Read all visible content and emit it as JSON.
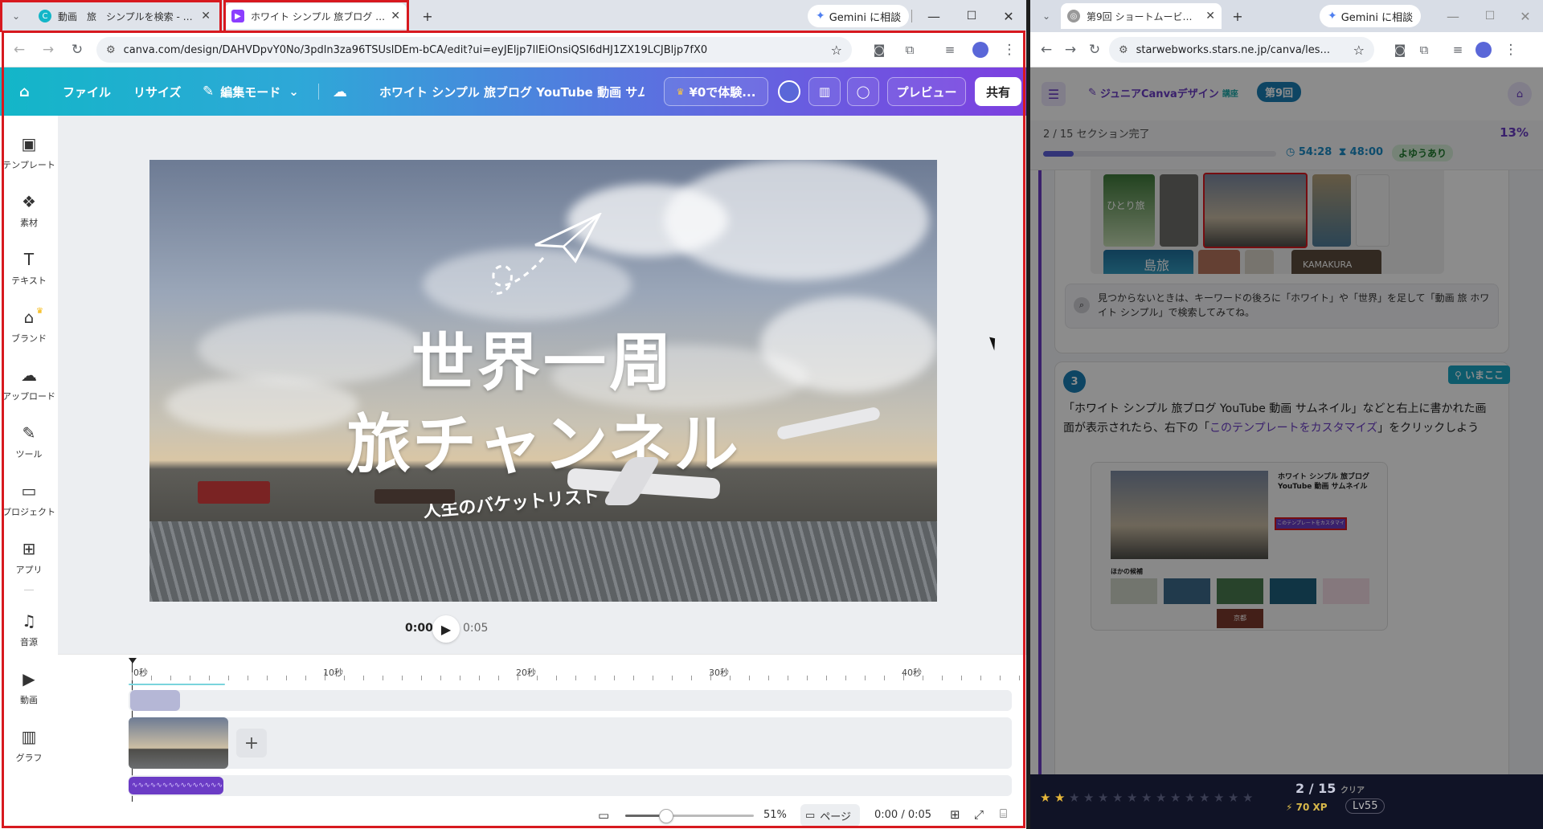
{
  "left_browser": {
    "tabs": [
      {
        "title": "動画　旅　シンプルを検索 - Canva",
        "favicon": "canva-icon"
      },
      {
        "title": "ホワイト シンプル 旅ブログ YouTube",
        "favicon": "video-icon"
      }
    ],
    "gemini_label": "Gemini に相談",
    "url": "canva.com/design/DAHVDpvY0No/3pdln3za96TSUslDEm-bCA/edit?ui=eyJEljp7llEiOnsiQSI6dHJ1ZX19LCJBljp7fX0"
  },
  "canva_header": {
    "file": "ファイル",
    "resize": "リサイズ",
    "edit_mode": "編集モード",
    "design_title": "ホワイト シンプル 旅ブログ YouTube 動画 サムネ...",
    "trial": "¥0で体験...",
    "preview": "プレビュー",
    "share": "共有"
  },
  "sidebar": {
    "items": [
      {
        "label": "テンプレート",
        "icon": "template-icon"
      },
      {
        "label": "素材",
        "icon": "elements-icon"
      },
      {
        "label": "テキスト",
        "icon": "text-icon"
      },
      {
        "label": "ブランド",
        "icon": "brand-icon"
      },
      {
        "label": "アップロード",
        "icon": "upload-icon"
      },
      {
        "label": "ツール",
        "icon": "tools-icon"
      },
      {
        "label": "プロジェクト",
        "icon": "folder-icon"
      },
      {
        "label": "アプリ",
        "icon": "apps-icon"
      },
      {
        "label": "音源",
        "icon": "music-icon"
      },
      {
        "label": "動画",
        "icon": "video-icon"
      },
      {
        "label": "グラフ",
        "icon": "chart-icon"
      }
    ]
  },
  "design": {
    "line1": "世界一周",
    "line2": "旅チャンネル",
    "subtitle": "人生のバケットリスト"
  },
  "player": {
    "current": "0:00",
    "total": "0:05"
  },
  "timeline": {
    "labels": [
      "0秒",
      "10秒",
      "20秒",
      "30秒",
      "40秒"
    ]
  },
  "status": {
    "zoom": "51%",
    "page": "ページ",
    "time": "0:00 / 0:05"
  },
  "right_browser": {
    "tab_title": "第9回 ショートムービーを作ろう | ジ...",
    "gemini_label": "Gemini に相談",
    "url": "starwebworks.stars.ne.jp/canva/les..."
  },
  "lesson": {
    "course": "ジュニアCanvaデザイン",
    "course_tag": "講座",
    "badge": "第9回",
    "progress_text": "2 / 15 セクション完了",
    "progress_pct": "13%",
    "progress_value": 0.13,
    "time_elapsed": "54:28",
    "time_limit": "48:00",
    "pace": "よゆうあり",
    "tip": "見つからないときは、キーワードの後ろに「ホワイト」や「世界」を足して「動画 旅 ホワイト シンプル」で検索してみてね。",
    "step_number": "3",
    "here": "いまここ",
    "instruction_pre": "「ホワイト シンプル 旅ブログ YouTube 動画 サムネイル」などと右上に書かれた画面が表示されたら、右下の「",
    "instruction_link": "このテンプレートをカスタマイズ",
    "instruction_post": "」をクリックしよう",
    "shot_title": "ホワイト シンプル 旅ブログ YouTube 動画 サムネイル",
    "shot_button": "このテンプレートをカスタマイズ",
    "shot_others": "ほかの候補",
    "thumb_labels": [
      "ひとり旅",
      "島旅",
      "KAMAKURA",
      "京都"
    ]
  },
  "footer": {
    "score": "2 / 15",
    "score_suffix": "クリア",
    "xp": "70 XP",
    "level": "Lv55",
    "stars_filled": 2,
    "stars_total": 15
  }
}
